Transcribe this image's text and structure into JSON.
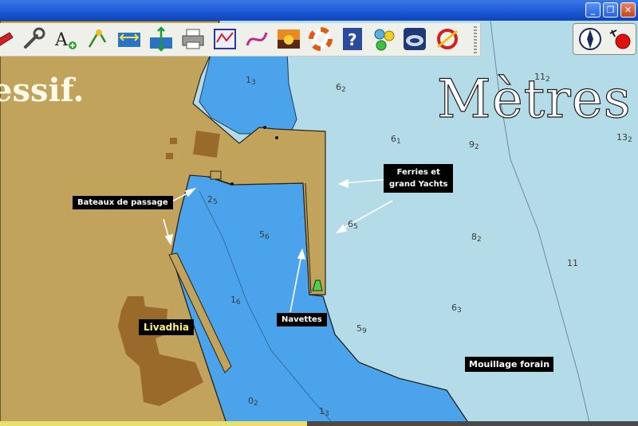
{
  "window": {
    "minimize_glyph": "_",
    "restore_glyph": "❐",
    "close_glyph": "✕"
  },
  "toolbar": {
    "tools": [
      {
        "icon": "boat-icon"
      },
      {
        "icon": "wrench-icon"
      },
      {
        "icon": "add-text-icon"
      },
      {
        "icon": "waypoint-icon"
      },
      {
        "icon": "measure-distance-icon"
      },
      {
        "icon": "depth-icon"
      },
      {
        "icon": "print-icon"
      },
      {
        "icon": "chart-overlay-icon"
      },
      {
        "icon": "route-icon"
      },
      {
        "icon": "sunset-icon"
      },
      {
        "icon": "lifebuoy-icon"
      },
      {
        "icon": "help-icon"
      },
      {
        "icon": "settings-icon"
      },
      {
        "icon": "gps-device-icon"
      },
      {
        "icon": "lifeline-icon"
      }
    ]
  },
  "right_panel": {
    "icons": [
      "compass-icon",
      "record-icon"
    ]
  },
  "map": {
    "big_labels": {
      "metres": "Mètres",
      "massif": "essif."
    },
    "annotations": {
      "bateaux": "Bateaux de passage",
      "ferries_line1": "Ferries et",
      "ferries_line2": "grand Yachts",
      "navettes": "Navettes",
      "town": "Livadhia",
      "mouillage": "Mouillage forain"
    },
    "depths": [
      {
        "main": "1",
        "sub": "3"
      },
      {
        "main": "6",
        "sub": "2"
      },
      {
        "main": "11",
        "sub": "2"
      },
      {
        "main": "6",
        "sub": "1"
      },
      {
        "main": "9",
        "sub": "2"
      },
      {
        "main": "13",
        "sub": "2"
      },
      {
        "main": "2",
        "sub": "5"
      },
      {
        "main": "5",
        "sub": "6"
      },
      {
        "main": "6",
        "sub": "5"
      },
      {
        "main": "8",
        "sub": "2"
      },
      {
        "main": "11",
        "sub": ""
      },
      {
        "main": "1",
        "sub": "6"
      },
      {
        "main": "6",
        "sub": "3"
      },
      {
        "main": "5",
        "sub": "9"
      },
      {
        "main": "0",
        "sub": "2"
      },
      {
        "main": "1",
        "sub": "3"
      }
    ]
  },
  "colors": {
    "land": "#c2a35c",
    "shallow_water": "#4ba3ec",
    "deep_water": "#b4dce8",
    "building": "#9a6a2a"
  }
}
